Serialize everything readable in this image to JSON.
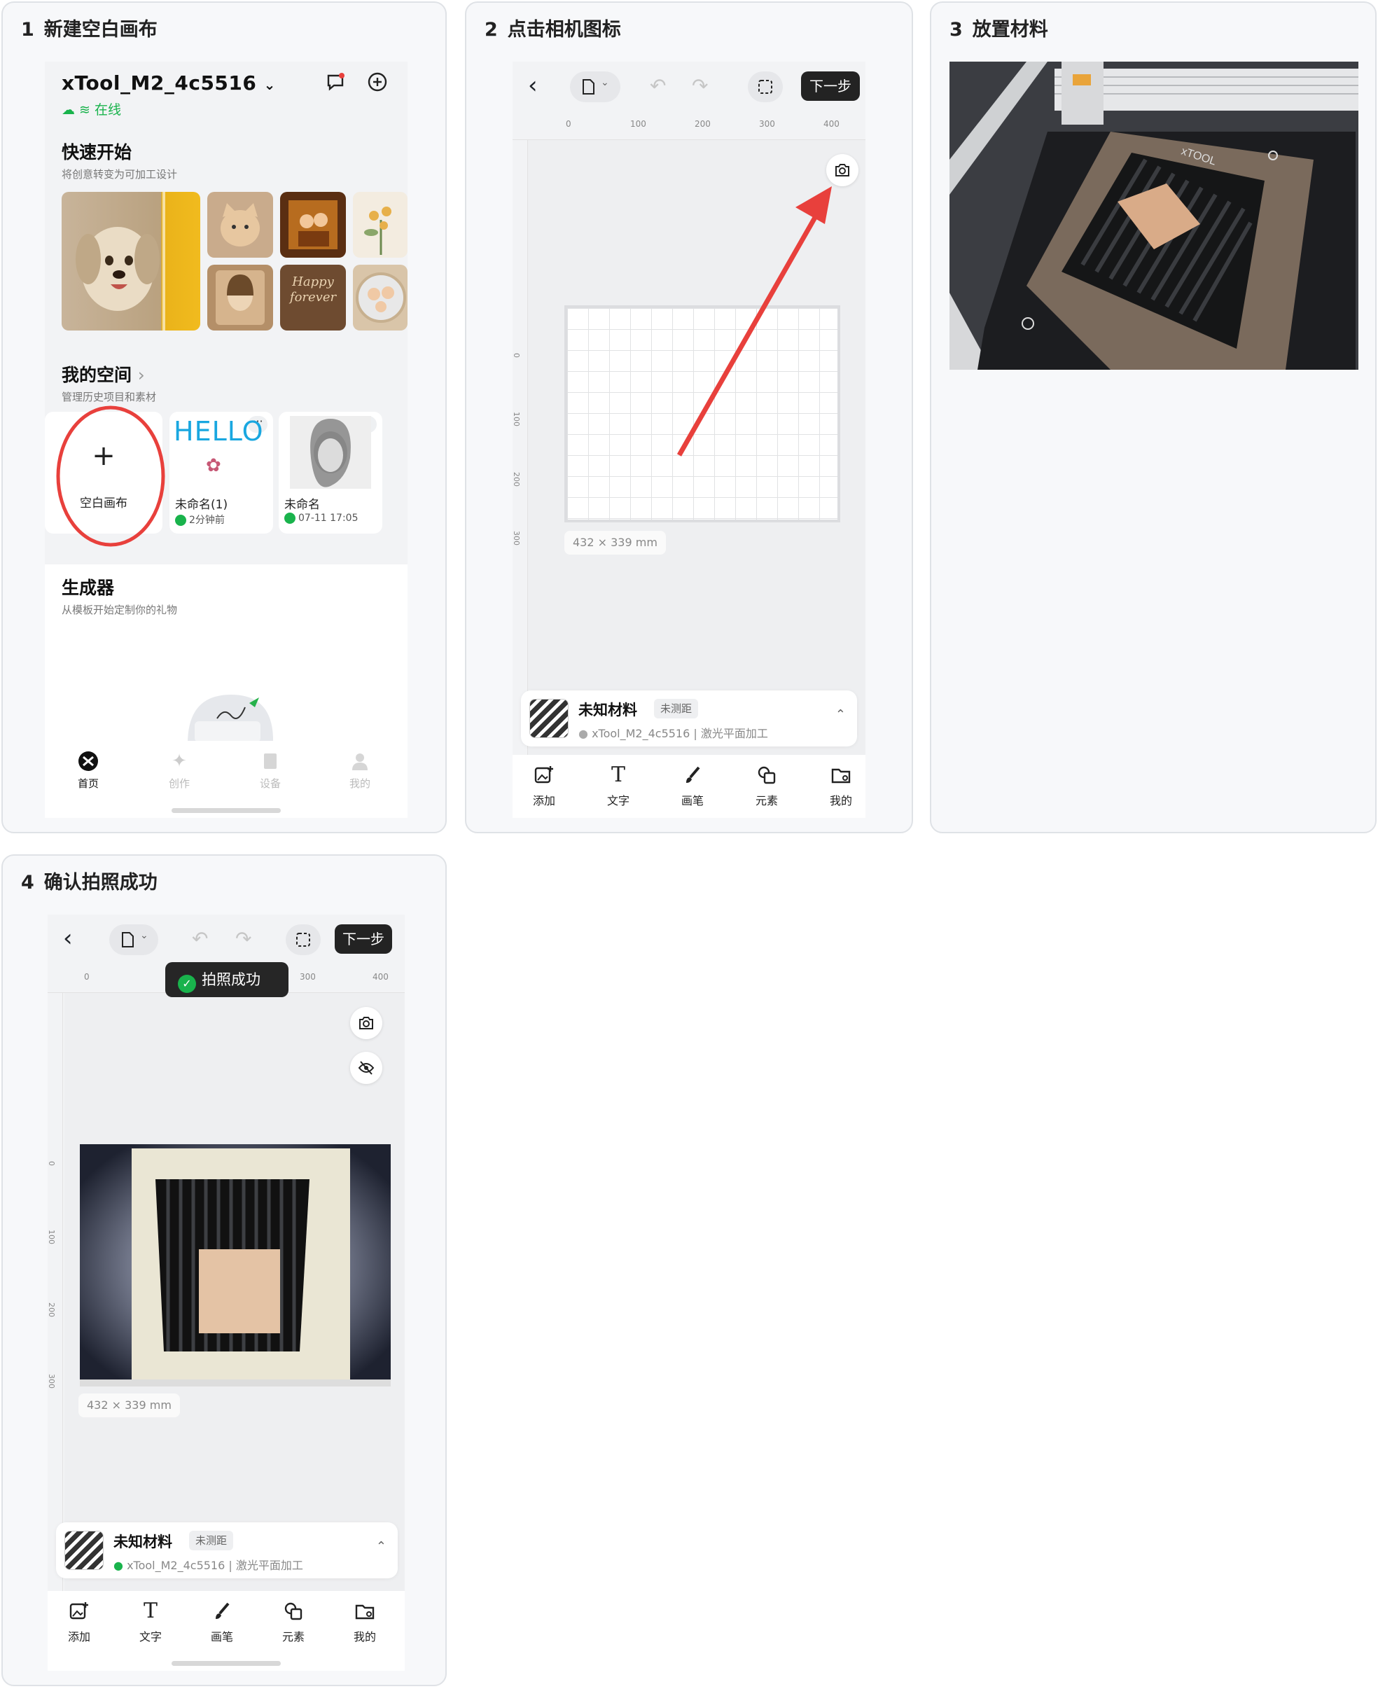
{
  "cards": [
    {
      "number": "1",
      "title": "新建空白画布"
    },
    {
      "number": "2",
      "title": "点击相机图标"
    },
    {
      "number": "3",
      "title": "放置材料"
    },
    {
      "number": "4",
      "title": "确认拍照成功"
    }
  ],
  "home": {
    "device_name": "xTool_M2_4c5516",
    "status": "在线",
    "quick_start_title": "快速开始",
    "quick_start_sub": "将创意转变为可加工设计",
    "my_space_title": "我的空间",
    "my_space_sub": "管理历史项目和素材",
    "blank_canvas_label": "空白画布",
    "hello_text": "HELLO",
    "projects": [
      {
        "name": "未命名(1)",
        "time": "2分钟前"
      },
      {
        "name": "未命名",
        "time": "07-11 17:05"
      }
    ],
    "generator_title": "生成器",
    "generator_sub": "从模板开始定制你的礼物",
    "tabs": [
      "首页",
      "创作",
      "设备",
      "我的"
    ],
    "thumb_text": "Happy forever"
  },
  "editor": {
    "next_label": "下一步",
    "ruler_x": [
      "0",
      "100",
      "200",
      "300",
      "400"
    ],
    "ruler_y": [
      "0",
      "100",
      "200",
      "300"
    ],
    "size_label": "432 × 339 mm",
    "material_name": "未知材料",
    "distance_tag": "未测距",
    "device_info": "xTool_M2_4c5516",
    "mode_info": "激光平面加工",
    "tools": [
      "添加",
      "文字",
      "画笔",
      "元素",
      "我的"
    ],
    "toast": "拍照成功",
    "brand": "xTOOL"
  },
  "colors": {
    "online": "#19b34c",
    "accent_red": "#e8403c",
    "dark_btn": "#232323"
  }
}
